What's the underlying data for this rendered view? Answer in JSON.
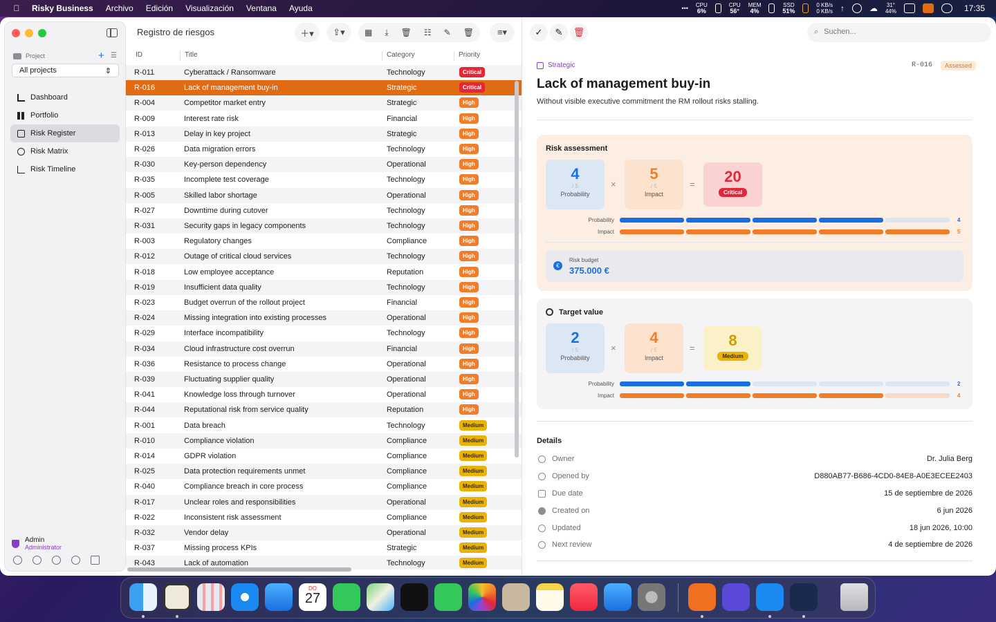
{
  "menubar": {
    "app_name": "Risky Business",
    "menus": [
      "Archivo",
      "Edición",
      "Visualización",
      "Ventana",
      "Ayuda"
    ],
    "stats": [
      {
        "label": "CPU",
        "value": "6%"
      },
      {
        "label": "CPU",
        "value": "56°"
      },
      {
        "label": "MEM",
        "value": "4%"
      },
      {
        "label": "SSD",
        "value": "51%"
      }
    ],
    "net_up": "0 KB/s",
    "net_down": "0 KB/s",
    "weather_temp": "31°",
    "weather_hum": "44%",
    "time": "17:35"
  },
  "sidebar": {
    "project_label": "Project",
    "project_select": "All projects",
    "nav": [
      {
        "label": "Dashboard",
        "icon": "chart-bar-icon"
      },
      {
        "label": "Portfolio",
        "icon": "grid-icon"
      },
      {
        "label": "Risk Register",
        "icon": "document-icon",
        "active": true
      },
      {
        "label": "Risk Matrix",
        "icon": "target-icon"
      },
      {
        "label": "Risk Timeline",
        "icon": "line-chart-icon"
      }
    ],
    "user_name": "Admin",
    "user_role": "Administrator"
  },
  "register": {
    "title": "Registro de riesgos",
    "columns": [
      "ID",
      "Title",
      "Category",
      "Priority"
    ],
    "rows": [
      [
        "R-011",
        "Cyberattack / Ransomware",
        "Technology",
        "Critical"
      ],
      [
        "R-016",
        "Lack of management buy-in",
        "Strategic",
        "Critical"
      ],
      [
        "R-004",
        "Competitor market entry",
        "Strategic",
        "High"
      ],
      [
        "R-009",
        "Interest rate risk",
        "Financial",
        "High"
      ],
      [
        "R-013",
        "Delay in key project",
        "Strategic",
        "High"
      ],
      [
        "R-026",
        "Data migration errors",
        "Technology",
        "High"
      ],
      [
        "R-030",
        "Key-person dependency",
        "Operational",
        "High"
      ],
      [
        "R-035",
        "Incomplete test coverage",
        "Technology",
        "High"
      ],
      [
        "R-005",
        "Skilled labor shortage",
        "Operational",
        "High"
      ],
      [
        "R-027",
        "Downtime during cutover",
        "Technology",
        "High"
      ],
      [
        "R-031",
        "Security gaps in legacy components",
        "Technology",
        "High"
      ],
      [
        "R-003",
        "Regulatory changes",
        "Compliance",
        "High"
      ],
      [
        "R-012",
        "Outage of critical cloud services",
        "Technology",
        "High"
      ],
      [
        "R-018",
        "Low employee acceptance",
        "Reputation",
        "High"
      ],
      [
        "R-019",
        "Insufficient data quality",
        "Technology",
        "High"
      ],
      [
        "R-023",
        "Budget overrun of the rollout project",
        "Financial",
        "High"
      ],
      [
        "R-024",
        "Missing integration into existing processes",
        "Operational",
        "High"
      ],
      [
        "R-029",
        "Interface incompatibility",
        "Technology",
        "High"
      ],
      [
        "R-034",
        "Cloud infrastructure cost overrun",
        "Financial",
        "High"
      ],
      [
        "R-036",
        "Resistance to process change",
        "Operational",
        "High"
      ],
      [
        "R-039",
        "Fluctuating supplier quality",
        "Operational",
        "High"
      ],
      [
        "R-041",
        "Knowledge loss through turnover",
        "Operational",
        "High"
      ],
      [
        "R-044",
        "Reputational risk from service quality",
        "Reputation",
        "High"
      ],
      [
        "R-001",
        "Data breach",
        "Technology",
        "Medium"
      ],
      [
        "R-010",
        "Compliance violation",
        "Compliance",
        "Medium"
      ],
      [
        "R-014",
        "GDPR violation",
        "Compliance",
        "Medium"
      ],
      [
        "R-025",
        "Data protection requirements unmet",
        "Compliance",
        "Medium"
      ],
      [
        "R-040",
        "Compliance breach in core process",
        "Compliance",
        "Medium"
      ],
      [
        "R-017",
        "Unclear roles and responsibilities",
        "Operational",
        "Medium"
      ],
      [
        "R-022",
        "Inconsistent risk assessment",
        "Compliance",
        "Medium"
      ],
      [
        "R-032",
        "Vendor delay",
        "Operational",
        "Medium"
      ],
      [
        "R-037",
        "Missing process KPIs",
        "Strategic",
        "Medium"
      ],
      [
        "R-043",
        "Lack of automation",
        "Technology",
        "Medium"
      ]
    ],
    "selected_index": 1
  },
  "detail": {
    "search_placeholder": "Suchen...",
    "category": "Strategic",
    "id": "R-016",
    "status": "Assessed",
    "title": "Lack of management buy-in",
    "description": "Without visible executive commitment the RM rollout risks stalling.",
    "assessment": {
      "heading": "Risk assessment",
      "probability": "4",
      "probability_max": "/ 5",
      "probability_label": "Probability",
      "impact": "5",
      "impact_max": "/ 5",
      "impact_label": "Impact",
      "score": "20",
      "score_label": "Critical",
      "prob_level": 4,
      "impact_level": 5,
      "budget_label": "Risk budget",
      "budget_value": "375.000 €"
    },
    "target": {
      "heading": "Target value",
      "probability": "2",
      "probability_max": "/ 5",
      "probability_label": "Probability",
      "impact": "4",
      "impact_max": "/ 5",
      "impact_label": "Impact",
      "score": "8",
      "score_label": "Medium",
      "prob_level": 2,
      "impact_level": 4
    },
    "details_heading": "Details",
    "details": [
      {
        "key": "Owner",
        "value": "Dr. Julia Berg"
      },
      {
        "key": "Opened by",
        "value": "D880AB77-B686-4CD0-84E8-A0E3ECEE2403"
      },
      {
        "key": "Due date",
        "value": "15 de septiembre de 2026"
      },
      {
        "key": "Created on",
        "value": "6 jun 2026"
      },
      {
        "key": "Updated",
        "value": "18 jun 2026, 10:00"
      },
      {
        "key": "Next review",
        "value": "4 de septiembre de 2026"
      }
    ]
  },
  "dock": {
    "calendar_month": "DO",
    "calendar_day": "27",
    "apps": [
      "Finder",
      "Textastic",
      "Launchpad",
      "Safari",
      "Mail",
      "Calendar",
      "Messages",
      "Maps",
      "TV",
      "FaceTime",
      "Photos",
      "Contacts",
      "Notes",
      "Music",
      "App Store",
      "System Settings",
      "Rewind",
      "Linear",
      "Xcode",
      "Instruments",
      "Trash"
    ]
  },
  "colors": {
    "accent": "#e06b12",
    "critical": "#e0283a",
    "high": "#f07d2a",
    "medium": "#e8b208",
    "probability": "#1a6fe0"
  }
}
